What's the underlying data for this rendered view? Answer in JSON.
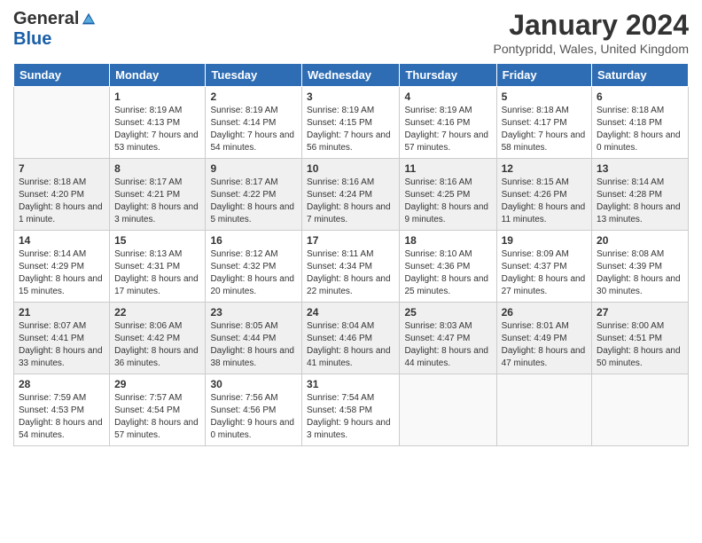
{
  "header": {
    "logo_general": "General",
    "logo_blue": "Blue",
    "title": "January 2024",
    "location": "Pontypridd, Wales, United Kingdom"
  },
  "days_of_week": [
    "Sunday",
    "Monday",
    "Tuesday",
    "Wednesday",
    "Thursday",
    "Friday",
    "Saturday"
  ],
  "weeks": [
    [
      {
        "day": "",
        "sunrise": "",
        "sunset": "",
        "daylight": ""
      },
      {
        "day": "1",
        "sunrise": "Sunrise: 8:19 AM",
        "sunset": "Sunset: 4:13 PM",
        "daylight": "Daylight: 7 hours and 53 minutes."
      },
      {
        "day": "2",
        "sunrise": "Sunrise: 8:19 AM",
        "sunset": "Sunset: 4:14 PM",
        "daylight": "Daylight: 7 hours and 54 minutes."
      },
      {
        "day": "3",
        "sunrise": "Sunrise: 8:19 AM",
        "sunset": "Sunset: 4:15 PM",
        "daylight": "Daylight: 7 hours and 56 minutes."
      },
      {
        "day": "4",
        "sunrise": "Sunrise: 8:19 AM",
        "sunset": "Sunset: 4:16 PM",
        "daylight": "Daylight: 7 hours and 57 minutes."
      },
      {
        "day": "5",
        "sunrise": "Sunrise: 8:18 AM",
        "sunset": "Sunset: 4:17 PM",
        "daylight": "Daylight: 7 hours and 58 minutes."
      },
      {
        "day": "6",
        "sunrise": "Sunrise: 8:18 AM",
        "sunset": "Sunset: 4:18 PM",
        "daylight": "Daylight: 8 hours and 0 minutes."
      }
    ],
    [
      {
        "day": "7",
        "sunrise": "Sunrise: 8:18 AM",
        "sunset": "Sunset: 4:20 PM",
        "daylight": "Daylight: 8 hours and 1 minute."
      },
      {
        "day": "8",
        "sunrise": "Sunrise: 8:17 AM",
        "sunset": "Sunset: 4:21 PM",
        "daylight": "Daylight: 8 hours and 3 minutes."
      },
      {
        "day": "9",
        "sunrise": "Sunrise: 8:17 AM",
        "sunset": "Sunset: 4:22 PM",
        "daylight": "Daylight: 8 hours and 5 minutes."
      },
      {
        "day": "10",
        "sunrise": "Sunrise: 8:16 AM",
        "sunset": "Sunset: 4:24 PM",
        "daylight": "Daylight: 8 hours and 7 minutes."
      },
      {
        "day": "11",
        "sunrise": "Sunrise: 8:16 AM",
        "sunset": "Sunset: 4:25 PM",
        "daylight": "Daylight: 8 hours and 9 minutes."
      },
      {
        "day": "12",
        "sunrise": "Sunrise: 8:15 AM",
        "sunset": "Sunset: 4:26 PM",
        "daylight": "Daylight: 8 hours and 11 minutes."
      },
      {
        "day": "13",
        "sunrise": "Sunrise: 8:14 AM",
        "sunset": "Sunset: 4:28 PM",
        "daylight": "Daylight: 8 hours and 13 minutes."
      }
    ],
    [
      {
        "day": "14",
        "sunrise": "Sunrise: 8:14 AM",
        "sunset": "Sunset: 4:29 PM",
        "daylight": "Daylight: 8 hours and 15 minutes."
      },
      {
        "day": "15",
        "sunrise": "Sunrise: 8:13 AM",
        "sunset": "Sunset: 4:31 PM",
        "daylight": "Daylight: 8 hours and 17 minutes."
      },
      {
        "day": "16",
        "sunrise": "Sunrise: 8:12 AM",
        "sunset": "Sunset: 4:32 PM",
        "daylight": "Daylight: 8 hours and 20 minutes."
      },
      {
        "day": "17",
        "sunrise": "Sunrise: 8:11 AM",
        "sunset": "Sunset: 4:34 PM",
        "daylight": "Daylight: 8 hours and 22 minutes."
      },
      {
        "day": "18",
        "sunrise": "Sunrise: 8:10 AM",
        "sunset": "Sunset: 4:36 PM",
        "daylight": "Daylight: 8 hours and 25 minutes."
      },
      {
        "day": "19",
        "sunrise": "Sunrise: 8:09 AM",
        "sunset": "Sunset: 4:37 PM",
        "daylight": "Daylight: 8 hours and 27 minutes."
      },
      {
        "day": "20",
        "sunrise": "Sunrise: 8:08 AM",
        "sunset": "Sunset: 4:39 PM",
        "daylight": "Daylight: 8 hours and 30 minutes."
      }
    ],
    [
      {
        "day": "21",
        "sunrise": "Sunrise: 8:07 AM",
        "sunset": "Sunset: 4:41 PM",
        "daylight": "Daylight: 8 hours and 33 minutes."
      },
      {
        "day": "22",
        "sunrise": "Sunrise: 8:06 AM",
        "sunset": "Sunset: 4:42 PM",
        "daylight": "Daylight: 8 hours and 36 minutes."
      },
      {
        "day": "23",
        "sunrise": "Sunrise: 8:05 AM",
        "sunset": "Sunset: 4:44 PM",
        "daylight": "Daylight: 8 hours and 38 minutes."
      },
      {
        "day": "24",
        "sunrise": "Sunrise: 8:04 AM",
        "sunset": "Sunset: 4:46 PM",
        "daylight": "Daylight: 8 hours and 41 minutes."
      },
      {
        "day": "25",
        "sunrise": "Sunrise: 8:03 AM",
        "sunset": "Sunset: 4:47 PM",
        "daylight": "Daylight: 8 hours and 44 minutes."
      },
      {
        "day": "26",
        "sunrise": "Sunrise: 8:01 AM",
        "sunset": "Sunset: 4:49 PM",
        "daylight": "Daylight: 8 hours and 47 minutes."
      },
      {
        "day": "27",
        "sunrise": "Sunrise: 8:00 AM",
        "sunset": "Sunset: 4:51 PM",
        "daylight": "Daylight: 8 hours and 50 minutes."
      }
    ],
    [
      {
        "day": "28",
        "sunrise": "Sunrise: 7:59 AM",
        "sunset": "Sunset: 4:53 PM",
        "daylight": "Daylight: 8 hours and 54 minutes."
      },
      {
        "day": "29",
        "sunrise": "Sunrise: 7:57 AM",
        "sunset": "Sunset: 4:54 PM",
        "daylight": "Daylight: 8 hours and 57 minutes."
      },
      {
        "day": "30",
        "sunrise": "Sunrise: 7:56 AM",
        "sunset": "Sunset: 4:56 PM",
        "daylight": "Daylight: 9 hours and 0 minutes."
      },
      {
        "day": "31",
        "sunrise": "Sunrise: 7:54 AM",
        "sunset": "Sunset: 4:58 PM",
        "daylight": "Daylight: 9 hours and 3 minutes."
      },
      {
        "day": "",
        "sunrise": "",
        "sunset": "",
        "daylight": ""
      },
      {
        "day": "",
        "sunrise": "",
        "sunset": "",
        "daylight": ""
      },
      {
        "day": "",
        "sunrise": "",
        "sunset": "",
        "daylight": ""
      }
    ]
  ]
}
